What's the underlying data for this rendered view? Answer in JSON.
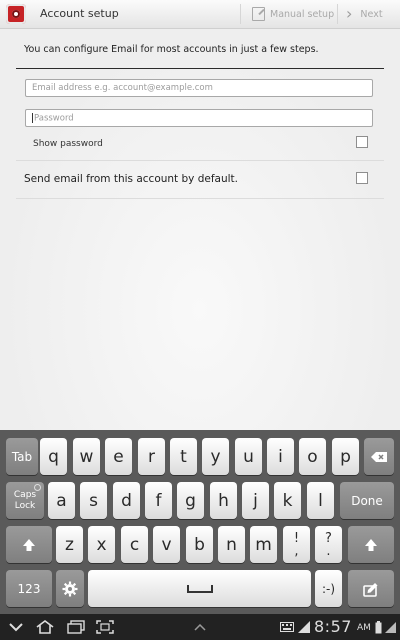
{
  "action_bar": {
    "title": "Account setup",
    "manual_setup_label": "Manual setup",
    "next_label": "Next"
  },
  "form": {
    "intro_text": "You can configure Email for most accounts in just a few steps.",
    "email_placeholder": "Email address e.g. account@example.com",
    "password_placeholder": "Password",
    "show_password_label": "Show password",
    "show_password_checked": false,
    "default_account_label": "Send email from this account by default.",
    "default_account_checked": false
  },
  "keyboard": {
    "row1": [
      "q",
      "w",
      "e",
      "r",
      "t",
      "y",
      "u",
      "i",
      "o",
      "p"
    ],
    "row2": [
      "a",
      "s",
      "d",
      "f",
      "g",
      "h",
      "j",
      "k",
      "l"
    ],
    "row3": [
      "z",
      "x",
      "c",
      "v",
      "b",
      "n",
      "m"
    ],
    "tab_label": "Tab",
    "caps_label": "Caps\nLock",
    "done_label": "Done",
    "num_label": "123",
    "smiley_label": ":-)",
    "punct1_top": "!",
    "punct1_bottom": ",",
    "punct2_top": "?",
    "punct2_bottom": "."
  },
  "status": {
    "time": "8:57",
    "ampm": "AM"
  },
  "colors": {
    "accent": "#c62326",
    "keyboard_bg": "#5a5a5a",
    "navbar_bg": "#222222"
  }
}
